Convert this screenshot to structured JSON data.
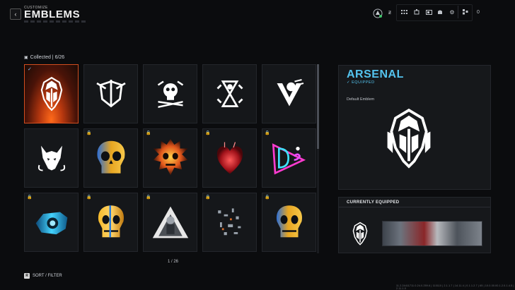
{
  "header": {
    "breadcrumb": "CUSTOMIZE",
    "title": "EMBLEMS",
    "back_icon": "chevron-left-icon",
    "top_right": {
      "grid_value": "12",
      "currency_value": "0"
    }
  },
  "collection": {
    "label": "Collected | 6/26"
  },
  "grid": {
    "tiles": [
      {
        "name": "arsenal",
        "locked": false,
        "selected": true,
        "equipped": true
      },
      {
        "name": "winged-sword",
        "locked": false
      },
      {
        "name": "skull-crossbones",
        "locked": false
      },
      {
        "name": "hourglass-skull",
        "locked": false
      },
      {
        "name": "winged-skull-v",
        "locked": false
      },
      {
        "name": "wolf",
        "locked": false
      },
      {
        "name": "blue-gold-skull",
        "locked": true
      },
      {
        "name": "fire-skull",
        "locked": true
      },
      {
        "name": "red-heart",
        "locked": true
      },
      {
        "name": "neon-die",
        "locked": true
      },
      {
        "name": "blue-mech",
        "locked": true
      },
      {
        "name": "gold-skull",
        "locked": true
      },
      {
        "name": "triangle-soldier",
        "locked": true
      },
      {
        "name": "shattered",
        "locked": true
      },
      {
        "name": "blue-gold-skull-2",
        "locked": true
      }
    ],
    "page": "1 / 26"
  },
  "sort": {
    "key": "R",
    "label": "SORT / FILTER"
  },
  "detail": {
    "title": "ARSENAL",
    "status": "EQUIPPED",
    "description": "Default Emblem"
  },
  "current": {
    "title": "CURRENTLY EQUIPPED"
  },
  "footer_id": "11.2.24411711.0.24.0.259.6 | 110110 | 2.1.1.7 | 14.11.4 | 0.1.1.2.7 | 65 | 10.0.00.00.1.2.0.1.4.5 | 2.11.1.0"
}
